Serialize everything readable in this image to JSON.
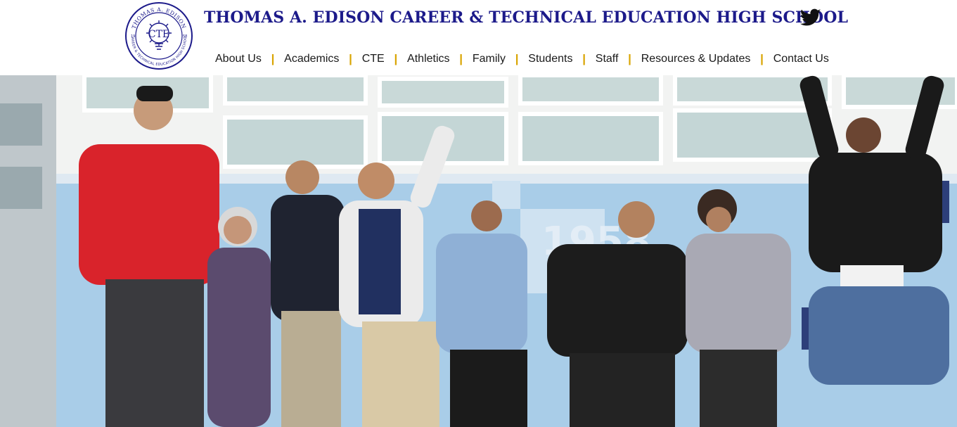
{
  "header": {
    "school_name": "THOMAS A. EDISON CAREER & TECHNICAL EDUCATION HIGH SCHOOL",
    "logo": {
      "ring_text_top": "THOMAS A. EDISON",
      "ring_text_bottom": "CAREER & TECHNICAL EDUCATION HIGH SCHOOL",
      "center_text": "CTE",
      "left_number": "19",
      "right_number": "58"
    },
    "social": {
      "icon": "twitter-icon"
    }
  },
  "nav": {
    "items": [
      {
        "label": "About Us"
      },
      {
        "label": "Academics"
      },
      {
        "label": "CTE"
      },
      {
        "label": "Athletics"
      },
      {
        "label": "Family"
      },
      {
        "label": "Students"
      },
      {
        "label": "Staff"
      },
      {
        "label": "Resources & Updates"
      },
      {
        "label": "Contact Us"
      }
    ],
    "separator": "|"
  },
  "hero": {
    "wall_text": "1958"
  },
  "colors": {
    "brand_navy": "#1c1a8a",
    "nav_separator": "#d9a400",
    "nav_text": "#1a1a1a",
    "tile_blue": "#a9cde8",
    "tile_navy": "#2d3f7a"
  }
}
